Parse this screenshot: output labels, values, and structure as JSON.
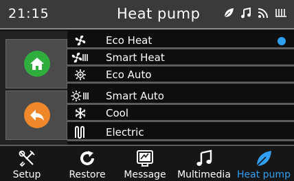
{
  "status_bar": {
    "time": "21:15",
    "title": "Heat pump",
    "icons": [
      "leaf-icon",
      "music-note-icon",
      "rss-icon",
      "heater-icon"
    ]
  },
  "side_buttons": [
    {
      "name": "home",
      "icon": "home-icon",
      "color": "#2fae3e"
    },
    {
      "name": "back",
      "icon": "back-arrow-icon",
      "color": "#f0872a"
    }
  ],
  "modes": [
    {
      "label": "Eco Heat",
      "icon": "fan-icon",
      "selected": true
    },
    {
      "label": "Smart Heat",
      "icon": "fan-heater-icon",
      "selected": false
    },
    {
      "label": "Eco Auto",
      "icon": "sun-snow-icon",
      "selected": false
    },
    {
      "label": "Smart Auto",
      "icon": "sun-snow-heater-icon",
      "selected": false
    },
    {
      "label": "Cool",
      "icon": "snowflake-icon",
      "selected": false
    },
    {
      "label": "Electric",
      "icon": "heater-coil-icon",
      "selected": false
    }
  ],
  "nav": [
    {
      "label": "Setup",
      "icon": "tools-icon",
      "active": false
    },
    {
      "label": "Restore",
      "icon": "refresh-icon",
      "active": false
    },
    {
      "label": "Message",
      "icon": "message-icon",
      "active": false
    },
    {
      "label": "Multimedia",
      "icon": "music-icon",
      "active": false
    },
    {
      "label": "Heat pump",
      "icon": "leaf-icon",
      "active": true
    }
  ],
  "colors": {
    "accent": "#2f9ff0",
    "home": "#2fae3e",
    "back": "#f0872a"
  }
}
